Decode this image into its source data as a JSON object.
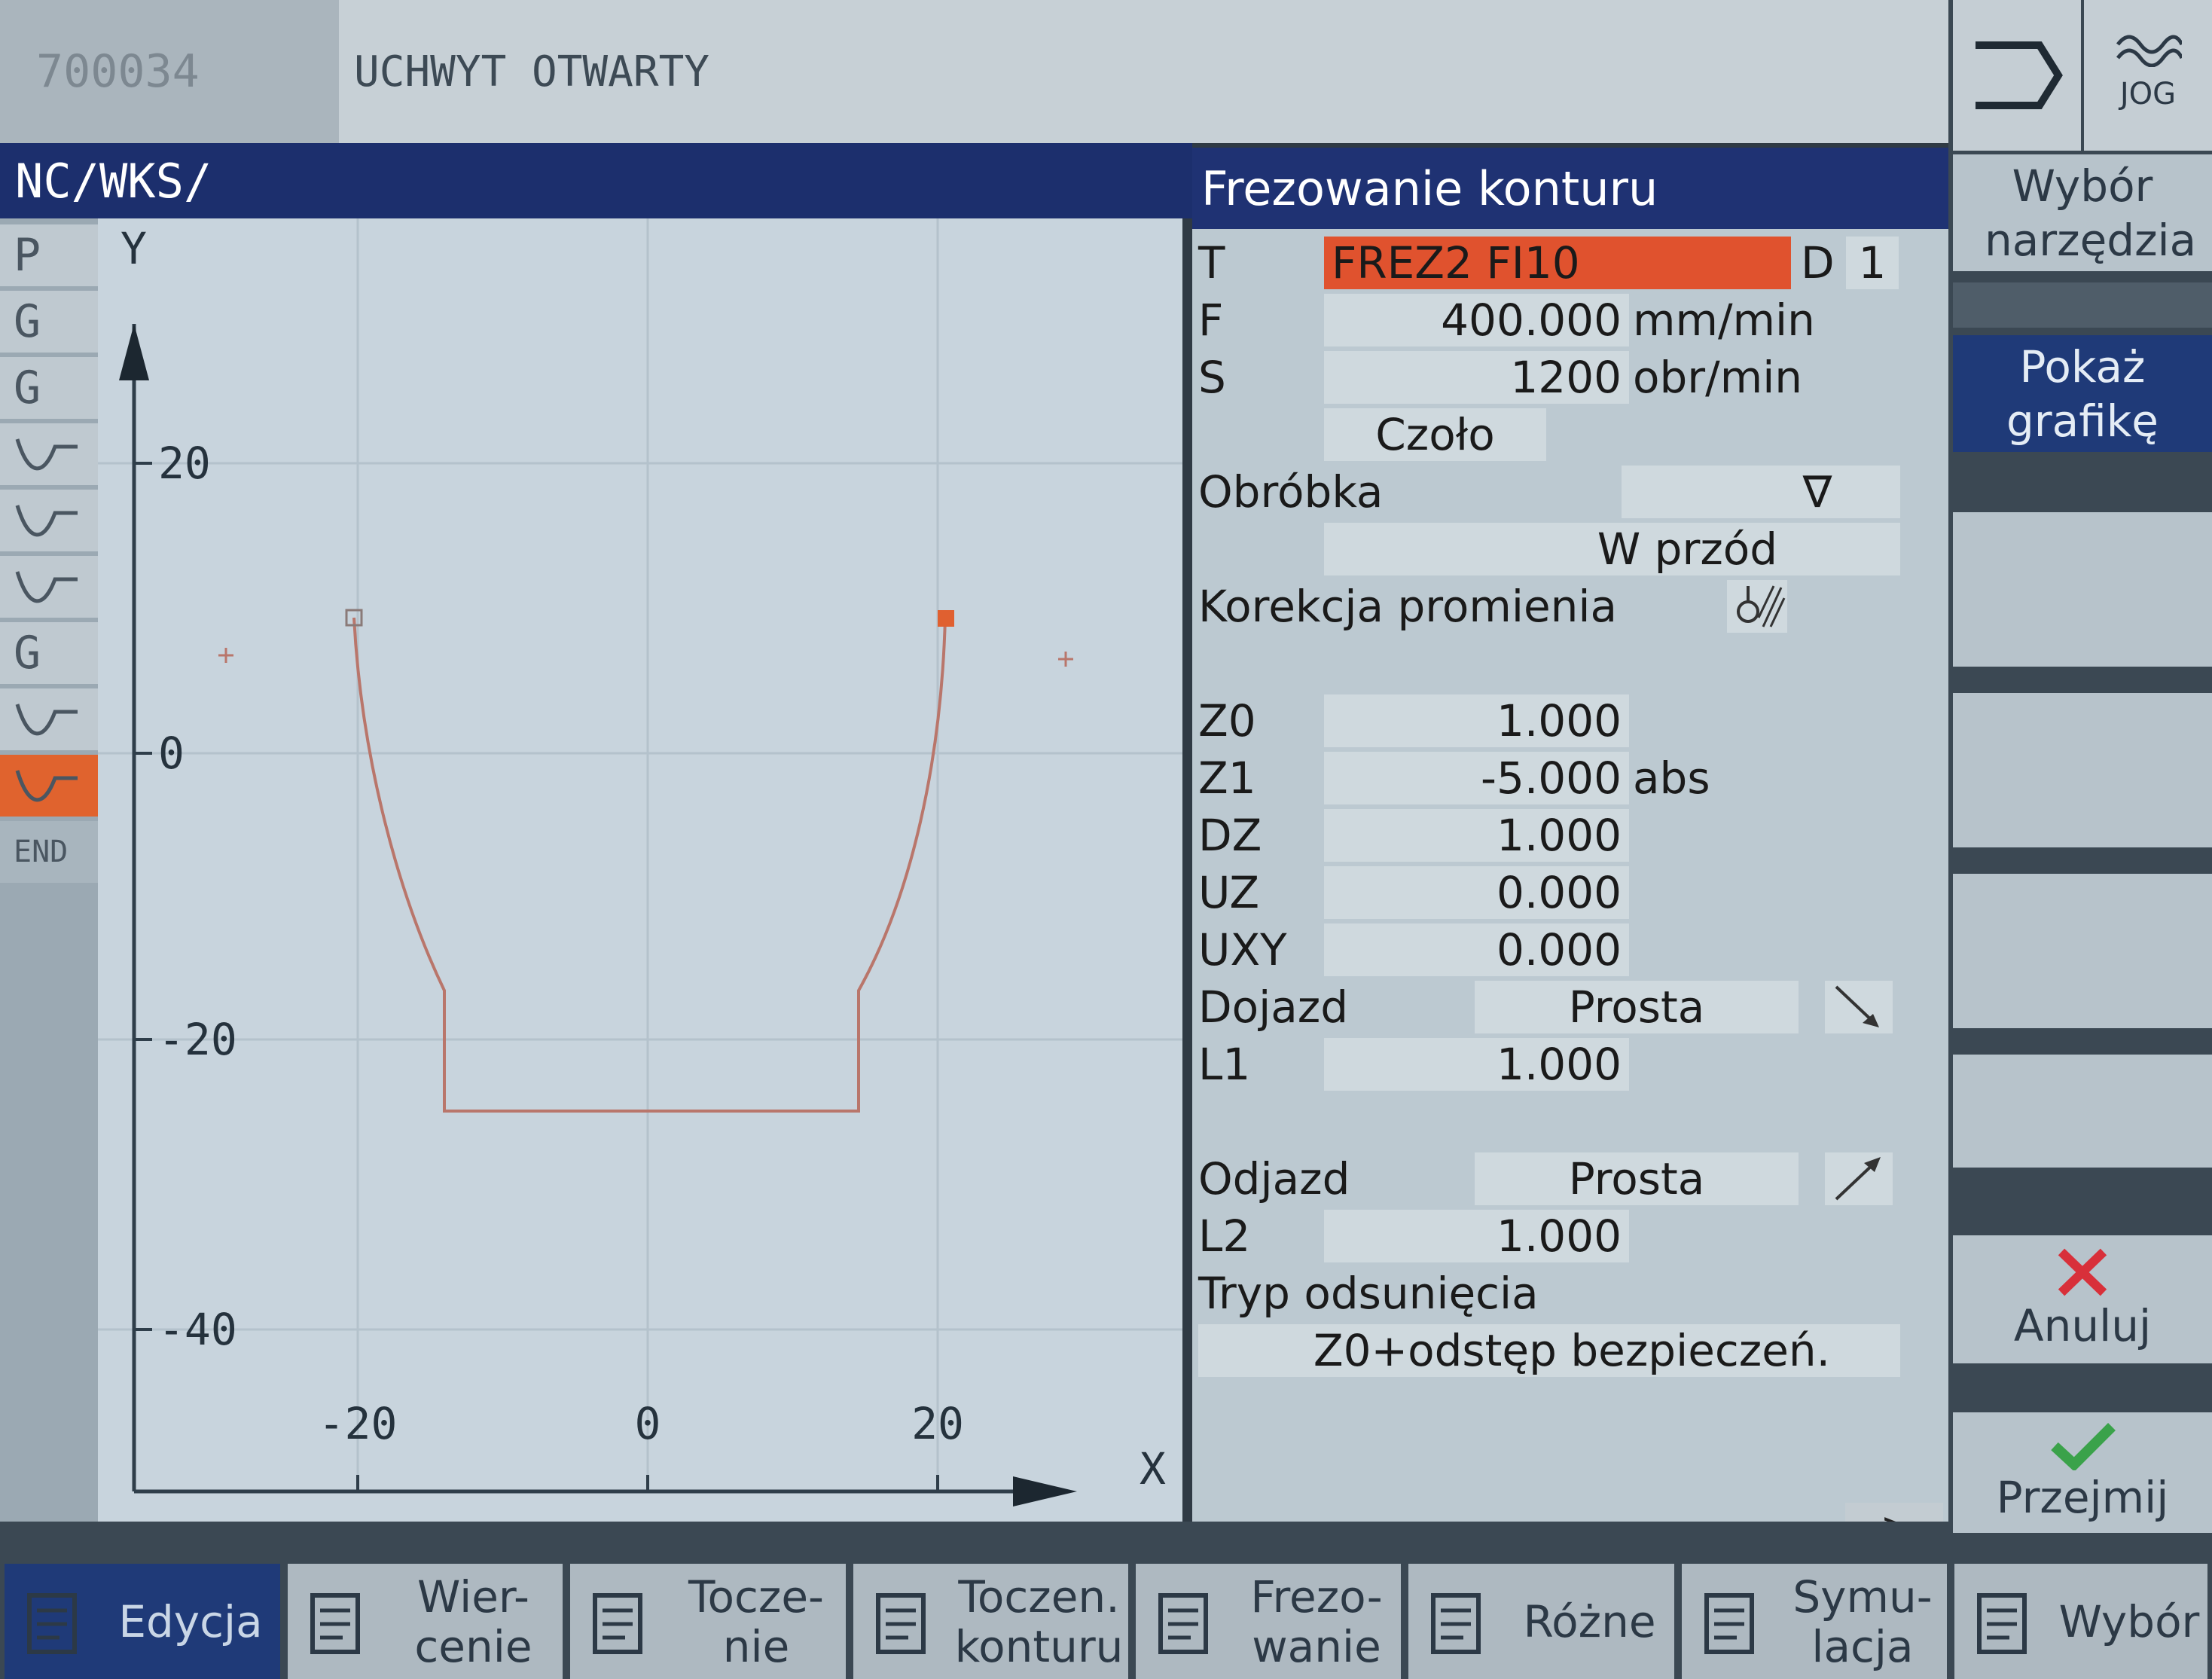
{
  "header": {
    "program_id": "700034",
    "program_name": "UCHWYT OTWARTY"
  },
  "nc_bar": {
    "label": "NC/WKS/"
  },
  "left_strip": {
    "items": [
      {
        "label": "P",
        "highlight": false
      },
      {
        "label": "G",
        "highlight": false
      },
      {
        "label": "G",
        "highlight": false
      },
      {
        "label": "",
        "icon": "contour-icon",
        "highlight": false
      },
      {
        "label": "",
        "icon": "pocket-mill-icon",
        "highlight": false
      },
      {
        "label": "",
        "icon": "pocket-mill-icon",
        "highlight": false
      },
      {
        "label": "G",
        "highlight": false
      },
      {
        "label": "",
        "icon": "curve-icon",
        "highlight": false
      },
      {
        "label": "",
        "icon": "contour-mill-icon",
        "highlight": true
      },
      {
        "label": "END",
        "highlight": false
      }
    ]
  },
  "graph": {
    "y_axis_label": "Y",
    "x_axis_label": "X",
    "y_ticks": [
      "20",
      "0",
      "-20",
      "-40"
    ],
    "x_ticks": [
      "-20",
      "0",
      "20"
    ],
    "contour_color": "#b9766b",
    "marker_color": "#e06030"
  },
  "panel": {
    "title": "Frezowanie konturu",
    "tool": {
      "label": "T",
      "value": "FREZ2 FI10",
      "d_label": "D",
      "d_value": "1",
      "color": "#e0522e"
    },
    "feed": {
      "label": "F",
      "value": "400.000",
      "unit": "mm/min"
    },
    "speed": {
      "label": "S",
      "value": "1200",
      "unit": "obr/min"
    },
    "plane": {
      "value": "Czoło"
    },
    "machining": {
      "label": "Obróbka",
      "value": "∇",
      "direction": "W przód"
    },
    "radius_comp": {
      "label": "Korekcja promienia"
    },
    "params": [
      {
        "label": "Z0",
        "value": "1.000",
        "unit": ""
      },
      {
        "label": "Z1",
        "value": "-5.000",
        "unit": "abs"
      },
      {
        "label": "DZ",
        "value": "1.000",
        "unit": ""
      },
      {
        "label": "UZ",
        "value": "0.000",
        "unit": ""
      },
      {
        "label": "UXY",
        "value": "0.000",
        "unit": ""
      }
    ],
    "approach": {
      "label": "Dojazd",
      "value": "Prosta",
      "l_label": "L1",
      "l_value": "1.000"
    },
    "retract": {
      "label": "Odjazd",
      "value": "Prosta",
      "l_label": "L2",
      "l_value": "1.000"
    },
    "lift": {
      "label": "Tryp odsunięcia",
      "value": "Z0+odstęp bezpieczeń."
    }
  },
  "right_softkeys": {
    "jog": "JOG",
    "tool_select": "Wybór narzędzia",
    "show_graphic": "Pokaż grafikę",
    "cancel": "Anuluj",
    "accept": "Przejmij",
    "more": ">"
  },
  "bottom_softkeys": [
    {
      "label": "Edycja",
      "icon": "edit-icon",
      "active": true
    },
    {
      "label": "Wier-\ncenie",
      "icon": "drilling-icon",
      "active": false
    },
    {
      "label": "Tocze-\nnie",
      "icon": "turning-icon",
      "active": false
    },
    {
      "label": "Toczen.\nkonturu",
      "icon": "contour-turning-icon",
      "active": false
    },
    {
      "label": "Frezo-\nwanie",
      "icon": "milling-icon",
      "active": false
    },
    {
      "label": "Różne",
      "icon": "misc-nc-icon",
      "active": false
    },
    {
      "label": "Symu-\nlacja",
      "icon": "simulation-icon",
      "active": false
    },
    {
      "label": "Wybór",
      "icon": "select-nc-icon",
      "active": false
    }
  ],
  "colors": {
    "title_bar": "#1f3273",
    "active_key": "#1f3a78",
    "tool_field": "#e0522e",
    "cancel": "#d8303a",
    "accept": "#3aa24a"
  }
}
